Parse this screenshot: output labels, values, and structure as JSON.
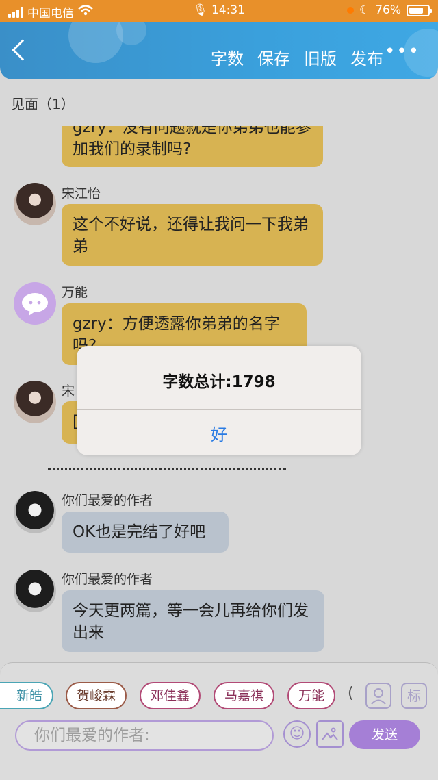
{
  "status_bar": {
    "carrier": "中国电信",
    "time": "14:31",
    "battery": "76%",
    "battery_level": 0.76
  },
  "header": {
    "back_icon": "chevron-left-icon",
    "menu": [
      "字数",
      "保存",
      "旧版",
      "发布"
    ],
    "more": "•••"
  },
  "chat": {
    "title": "见面（1）",
    "messages": [
      {
        "name": "",
        "text": "gzry：没有问题就是你弟弟也能参加我们的录制吗?"
      },
      {
        "name": "宋江怡",
        "text": "这个不好说，还得让我问一下我弟弟"
      },
      {
        "name": "万能",
        "text": "gzry：方便透露你弟弟的名字吗?"
      },
      {
        "name": "宋",
        "text": "[]"
      },
      {
        "name": "你们最爱的作者",
        "text": "OK也是完结了好吧"
      },
      {
        "name": "你们最爱的作者",
        "text": "今天更两篇，等一会儿再给你们发出来"
      }
    ]
  },
  "dialog": {
    "message": "字数总计:1798",
    "ok_label": "好"
  },
  "composer": {
    "chips": [
      "新皓",
      "贺峻霖",
      "邓佳鑫",
      "马嘉祺",
      "万能",
      "("
    ],
    "icon_avatar": "user-icon",
    "tag_label": "标",
    "placeholder": "你们最爱的作者:",
    "emoji_icon": "☺",
    "image_icon": "image-icon",
    "send_label": "发送"
  }
}
